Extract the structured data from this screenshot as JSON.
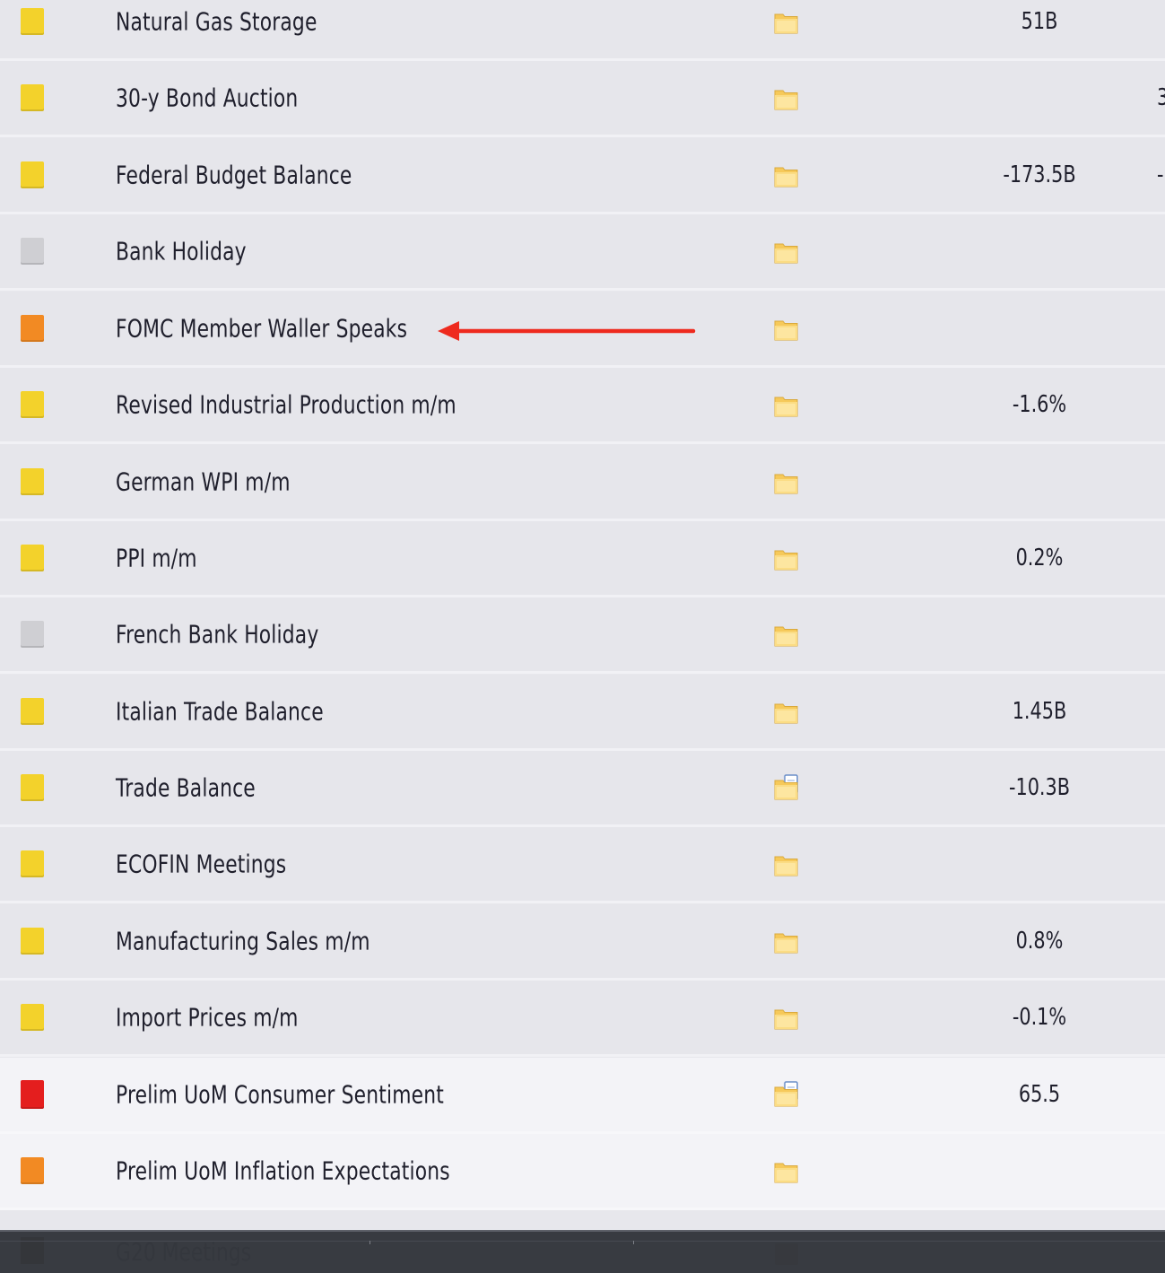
{
  "colors": {
    "high_impact": "#e41e1e",
    "medium_impact": "#f28a23",
    "low_impact": "#f3d22b",
    "non_economic": "#cfcfd3",
    "annotation_arrow": "#ee2a1e"
  },
  "events": [
    {
      "title": "Natural Gas Storage",
      "impact": "low",
      "detail_icon": "folder-icon",
      "actual": "51B",
      "forecast": ""
    },
    {
      "title": "30-y Bond Auction",
      "impact": "low",
      "detail_icon": "folder-icon",
      "actual": "",
      "forecast": "3"
    },
    {
      "title": "Federal Budget Balance",
      "impact": "low",
      "detail_icon": "folder-icon",
      "actual": "-173.5B",
      "forecast": "-"
    },
    {
      "title": "Bank Holiday",
      "impact": "non-economic",
      "detail_icon": "folder-icon",
      "actual": "",
      "forecast": ""
    },
    {
      "title": "FOMC Member Waller Speaks",
      "impact": "medium",
      "detail_icon": "folder-icon",
      "actual": "",
      "forecast": "",
      "annotated": true
    },
    {
      "title": "Revised Industrial Production m/m",
      "impact": "low",
      "detail_icon": "folder-icon",
      "actual": "-1.6%",
      "forecast": ""
    },
    {
      "title": "German WPI m/m",
      "impact": "low",
      "detail_icon": "folder-icon",
      "actual": "",
      "forecast": ""
    },
    {
      "title": "PPI m/m",
      "impact": "low",
      "detail_icon": "folder-icon",
      "actual": "0.2%",
      "forecast": ""
    },
    {
      "title": "French Bank Holiday",
      "impact": "non-economic",
      "detail_icon": "folder-icon",
      "actual": "",
      "forecast": ""
    },
    {
      "title": "Italian Trade Balance",
      "impact": "low",
      "detail_icon": "folder-icon",
      "actual": "1.45B",
      "forecast": ""
    },
    {
      "title": "Trade Balance",
      "impact": "low",
      "detail_icon": "folder-document-icon",
      "actual": "-10.3B",
      "forecast": ""
    },
    {
      "title": "ECOFIN Meetings",
      "impact": "low",
      "detail_icon": "folder-icon",
      "actual": "",
      "forecast": ""
    },
    {
      "title": "Manufacturing Sales m/m",
      "impact": "low",
      "detail_icon": "folder-icon",
      "actual": "0.8%",
      "forecast": ""
    },
    {
      "title": "Import Prices m/m",
      "impact": "low",
      "detail_icon": "folder-icon",
      "actual": "-0.1%",
      "forecast": ""
    },
    {
      "title": "Prelim UoM Consumer Sentiment",
      "impact": "high",
      "detail_icon": "folder-document-icon",
      "actual": "65.5",
      "forecast": "",
      "highlighted": true
    },
    {
      "title": "Prelim UoM Inflation Expectations",
      "impact": "medium",
      "detail_icon": "folder-icon",
      "actual": "",
      "forecast": "",
      "highlighted": true
    }
  ],
  "partially_hidden_event": {
    "title": "G20 Meetings",
    "impact": "medium",
    "detail_icon": "folder-icon"
  }
}
